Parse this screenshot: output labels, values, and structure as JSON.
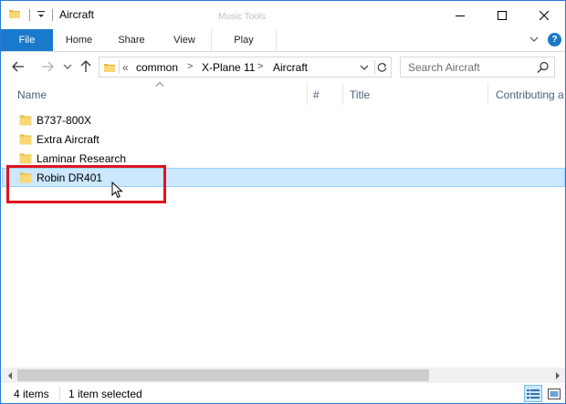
{
  "window": {
    "title": "Aircraft",
    "contextual_tab_group": "Music Tools"
  },
  "ribbon": {
    "tabs": [
      {
        "label": "File"
      },
      {
        "label": "Home"
      },
      {
        "label": "Share"
      },
      {
        "label": "View"
      },
      {
        "label": "Play"
      }
    ],
    "help_label": "?"
  },
  "navigation": {
    "overflow": "«",
    "breadcrumbs": [
      "common",
      "X-Plane 11",
      "Aircraft"
    ],
    "separator": ">",
    "search_placeholder": "Search Aircraft"
  },
  "columns": [
    "Name",
    "#",
    "Title",
    "Contributing a"
  ],
  "files": [
    {
      "name": "B737-800X",
      "type": "folder",
      "selected": false
    },
    {
      "name": "Extra Aircraft",
      "type": "folder",
      "selected": false
    },
    {
      "name": "Laminar Research",
      "type": "folder",
      "selected": false
    },
    {
      "name": "Robin DR401",
      "type": "folder",
      "selected": true
    }
  ],
  "status": {
    "item_count": "4 items",
    "selection": "1 item selected"
  },
  "colors": {
    "accent": "#1979ca",
    "selection": "#cce8ff",
    "highlight_annotation": "#e0141e",
    "folder": "#f8d775"
  }
}
